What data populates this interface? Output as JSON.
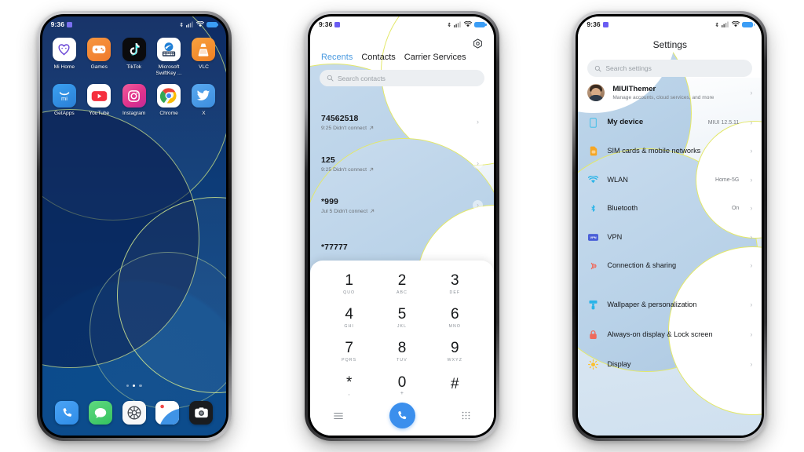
{
  "status_bar": {
    "time": "9:36",
    "battery": "full",
    "icons": [
      "bluetooth-icon",
      "signal-icon",
      "wifi-icon",
      "battery-icon"
    ]
  },
  "phone1_home": {
    "apps_row1": [
      {
        "label": "Mi Home",
        "icon": "mi-home-icon"
      },
      {
        "label": "Games",
        "icon": "games-icon"
      },
      {
        "label": "TikTok",
        "icon": "tiktok-icon"
      },
      {
        "label": "Microsoft SwiftKey ...",
        "icon": "swiftkey-icon"
      },
      {
        "label": "VLC",
        "icon": "vlc-icon"
      }
    ],
    "apps_row2": [
      {
        "label": "GetApps",
        "icon": "getapps-icon"
      },
      {
        "label": "YouTube",
        "icon": "youtube-icon"
      },
      {
        "label": "Instagram",
        "icon": "instagram-icon"
      },
      {
        "label": "Chrome",
        "icon": "chrome-icon"
      },
      {
        "label": "X",
        "icon": "x-twitter-icon"
      }
    ],
    "dock": [
      {
        "label": "Phone",
        "icon": "phone-icon"
      },
      {
        "label": "Messages",
        "icon": "messages-icon"
      },
      {
        "label": "Settings",
        "icon": "settings-gear-icon"
      },
      {
        "label": "Gallery",
        "icon": "gallery-icon"
      },
      {
        "label": "Camera",
        "icon": "camera-icon"
      }
    ],
    "page_dots": {
      "count": 3,
      "active_index": 1
    }
  },
  "phone2_dialer": {
    "gear_icon": "settings-gear-icon",
    "tabs": [
      {
        "label": "Recents",
        "active": true
      },
      {
        "label": "Contacts",
        "active": false
      },
      {
        "label": "Carrier Services",
        "active": false
      }
    ],
    "search": {
      "placeholder": "Search contacts",
      "icon": "search-icon"
    },
    "calls": [
      {
        "number": "74562518",
        "detail": "9:25 Didn't connect"
      },
      {
        "number": "125",
        "detail": "9:25 Didn't connect"
      },
      {
        "number": "*999",
        "detail": "Jul 5 Didn't connect"
      },
      {
        "number": "*77777",
        "detail": ""
      }
    ],
    "keypad": [
      {
        "digit": "1",
        "sub": "QUO"
      },
      {
        "digit": "2",
        "sub": "ABC"
      },
      {
        "digit": "3",
        "sub": "DEF"
      },
      {
        "digit": "4",
        "sub": "GHI"
      },
      {
        "digit": "5",
        "sub": "JKL"
      },
      {
        "digit": "6",
        "sub": "MNO"
      },
      {
        "digit": "7",
        "sub": "PQRS"
      },
      {
        "digit": "8",
        "sub": "TUV"
      },
      {
        "digit": "9",
        "sub": "WXYZ"
      },
      {
        "digit": "*",
        "sub": ","
      },
      {
        "digit": "0",
        "sub": "+"
      },
      {
        "digit": "#",
        "sub": ""
      }
    ],
    "bottom_bar": {
      "menu_icon": "hamburger-menu-icon",
      "call_icon": "phone-call-icon",
      "keypad_icon": "dialpad-grid-icon"
    }
  },
  "phone3_settings": {
    "title": "Settings",
    "search": {
      "placeholder": "Search settings",
      "icon": "search-icon"
    },
    "account": {
      "name": "MIUIThemer",
      "subtitle": "Manage accounts, cloud services, and more",
      "avatar": "user-avatar"
    },
    "items": [
      {
        "label": "My device",
        "value": "MIUI 12.5.11",
        "icon": "device-icon"
      },
      {
        "label": "SIM cards & mobile networks",
        "value": "",
        "icon": "sim-card-icon"
      },
      {
        "label": "WLAN",
        "value": "Home-5G",
        "icon": "wifi-icon"
      },
      {
        "label": "Bluetooth",
        "value": "On",
        "icon": "bluetooth-icon"
      },
      {
        "label": "VPN",
        "value": "",
        "icon": "vpn-icon"
      },
      {
        "label": "Connection & sharing",
        "value": "",
        "icon": "connection-sharing-icon"
      },
      {
        "label": "Wallpaper & personalization",
        "value": "",
        "icon": "wallpaper-brush-icon"
      },
      {
        "label": "Always-on display & Lock screen",
        "value": "",
        "icon": "lock-icon"
      },
      {
        "label": "Display",
        "value": "",
        "icon": "display-sun-icon"
      }
    ],
    "chevron": "chevron-right-icon"
  },
  "colors": {
    "accent_blue": "#3b8fed",
    "tab_active": "#4a9ae0",
    "wallpaper_dark": "#0d3c78",
    "wallpaper_arc": "#c8e182",
    "list_text": "#16181b",
    "muted_text": "#75797f"
  }
}
